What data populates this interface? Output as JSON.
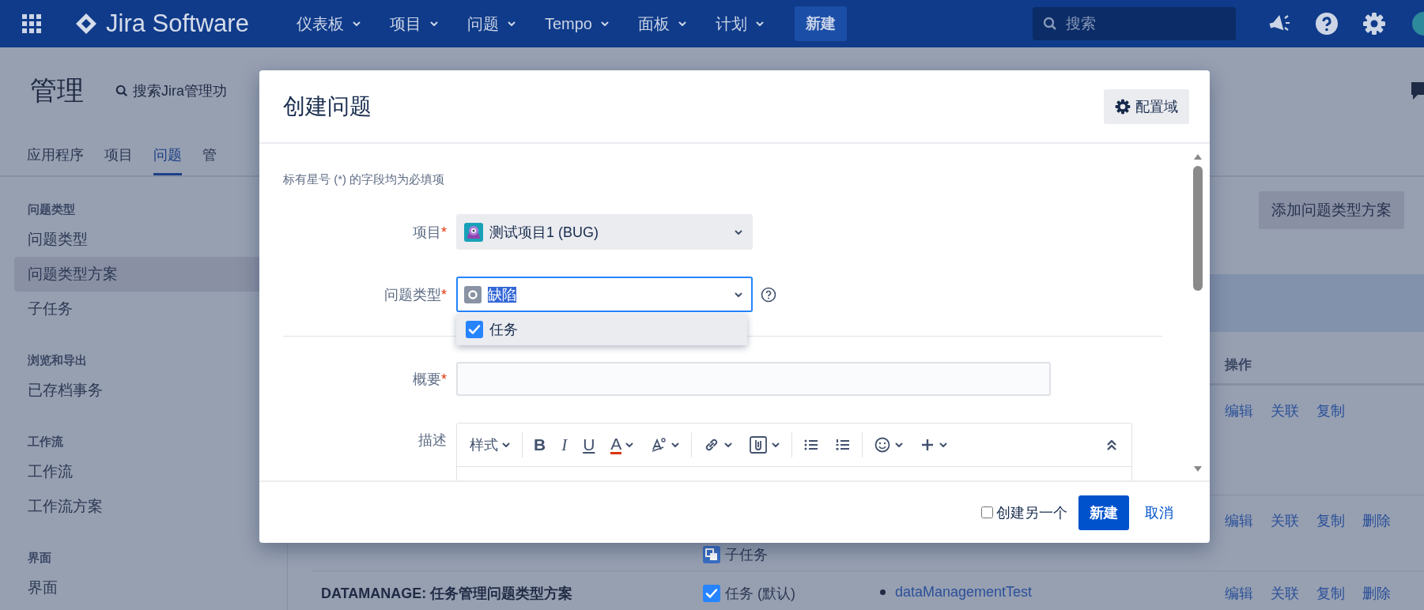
{
  "topbar": {
    "brand": "Jira Software",
    "menus": [
      {
        "label": "仪表板"
      },
      {
        "label": "项目"
      },
      {
        "label": "问题"
      },
      {
        "label": "Tempo"
      },
      {
        "label": "面板"
      },
      {
        "label": "计划"
      }
    ],
    "create": "新建",
    "search": {
      "placeholder": "搜索"
    }
  },
  "admin": {
    "title": "管理",
    "search": "搜索Jira管理功",
    "tabs": [
      {
        "label": "应用程序",
        "selected": false
      },
      {
        "label": "项目",
        "selected": false
      },
      {
        "label": "问题",
        "selected": true
      },
      {
        "label": "管",
        "selected": false
      }
    ]
  },
  "sidebar": {
    "sections": [
      {
        "heading": "问题类型",
        "items": [
          {
            "label": "问题类型",
            "selected": false
          },
          {
            "label": "问题类型方案",
            "selected": true
          },
          {
            "label": "子任务",
            "selected": false
          }
        ]
      },
      {
        "heading": "浏览和导出",
        "items": [
          {
            "label": "已存档事务",
            "selected": false
          }
        ]
      },
      {
        "heading": "工作流",
        "items": [
          {
            "label": "工作流",
            "selected": false
          },
          {
            "label": "工作流方案",
            "selected": false
          }
        ]
      },
      {
        "heading": "界面",
        "items": [
          {
            "label": "界面",
            "selected": false
          }
        ]
      }
    ]
  },
  "content": {
    "add_button": "添加问题类型方案",
    "action_column": "操作",
    "rows": [
      {
        "actions": [
          "编辑",
          "关联",
          "复制"
        ]
      },
      {
        "issue_types": [
          {
            "label": "子任务",
            "kind": "subtask"
          }
        ],
        "actions": [
          "编辑",
          "关联",
          "复制",
          "删除"
        ]
      },
      {
        "name": "DATAMANAGE: 任务管理问题类型方案",
        "issue_types": [
          {
            "label": "任务 (默认)",
            "kind": "task"
          }
        ],
        "projects": [
          "dataManagementTest"
        ],
        "actions": [
          "编辑",
          "关联",
          "复制",
          "删除"
        ]
      }
    ]
  },
  "dialog": {
    "title": "创建问题",
    "config_button": "配置域",
    "required_note": "标有星号 (*) 的字段均为必填项",
    "fields": [
      {
        "kind": "select",
        "label": "项目",
        "required_mark": "*",
        "value": "测试项目1 (BUG)",
        "focused": false,
        "text_selected": false
      },
      {
        "kind": "select",
        "label": "问题类型",
        "required_mark": "*",
        "value": "缺陷",
        "focused": true,
        "text_selected": true,
        "help": true,
        "options": [
          {
            "label": "任务",
            "kind": "task",
            "selected": true
          }
        ]
      },
      {
        "kind": "divider"
      },
      {
        "kind": "text",
        "label": "概要",
        "required_mark": "*"
      },
      {
        "kind": "editor",
        "label": "描述",
        "toolbar": [
          {
            "kind": "style",
            "label": "样式",
            "menu": true
          },
          {
            "kind": "separator"
          },
          {
            "kind": "bold",
            "label": "B"
          },
          {
            "kind": "italic",
            "label": "I"
          },
          {
            "kind": "underline",
            "label": "U"
          },
          {
            "kind": "color",
            "label": "A",
            "menu": true
          },
          {
            "kind": "clear",
            "menu": true
          },
          {
            "kind": "separator"
          },
          {
            "kind": "link",
            "menu": true
          },
          {
            "kind": "attach",
            "menu": true
          },
          {
            "kind": "separator"
          },
          {
            "kind": "bullets"
          },
          {
            "kind": "numbers"
          },
          {
            "kind": "separator"
          },
          {
            "kind": "emoji",
            "menu": true
          },
          {
            "kind": "insert",
            "menu": true
          },
          {
            "kind": "collapse"
          }
        ]
      }
    ],
    "create_another": {
      "label": "创建另一个",
      "checked": false
    },
    "submit": "新建",
    "cancel": "取消"
  }
}
